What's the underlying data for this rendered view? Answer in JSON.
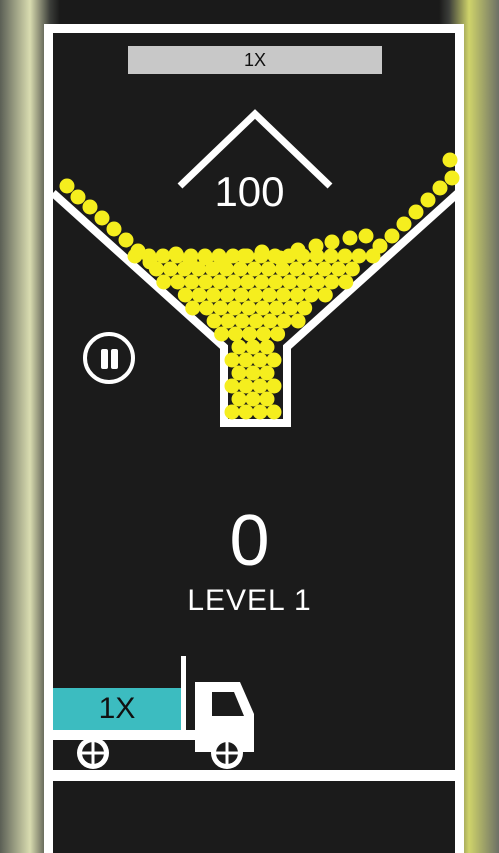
{
  "hud": {
    "multiplier_bar_label": "1X",
    "target_count": "100",
    "score": "0",
    "level_label": "LEVEL 1"
  },
  "truck": {
    "multiplier_label": "1X",
    "cargo_color": "#3cbcc0"
  },
  "colors": {
    "background": "#1b1b1b",
    "walls": "#ffffff",
    "balls": "#f5ee1e",
    "progress_bar": "#c8c8c8"
  },
  "icons": {
    "pause": "pause-icon",
    "wheel": "wheel-icon",
    "chevron": "chevron-up-icon"
  }
}
